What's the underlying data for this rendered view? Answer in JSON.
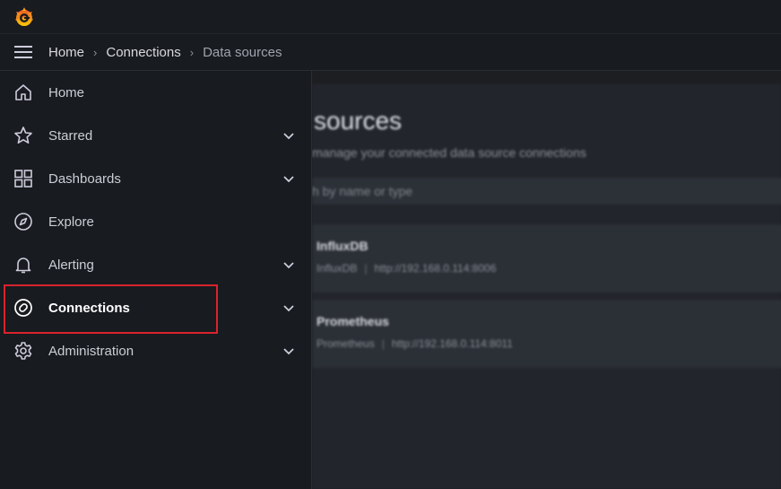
{
  "breadcrumb": {
    "items": [
      "Home",
      "Connections",
      "Data sources"
    ]
  },
  "sidebar": {
    "items": [
      {
        "label": "Home",
        "icon": "home-icon",
        "expandable": false
      },
      {
        "label": "Starred",
        "icon": "star-icon",
        "expandable": true
      },
      {
        "label": "Dashboards",
        "icon": "apps-icon",
        "expandable": true
      },
      {
        "label": "Explore",
        "icon": "compass-icon",
        "expandable": false
      },
      {
        "label": "Alerting",
        "icon": "bell-icon",
        "expandable": true
      },
      {
        "label": "Connections",
        "icon": "connections-icon",
        "expandable": true,
        "active": true
      },
      {
        "label": "Administration",
        "icon": "cog-icon",
        "expandable": true
      }
    ]
  },
  "main": {
    "title": "sources",
    "subtitle": "manage your connected data source connections",
    "search_placeholder": "h by name or type",
    "datasources": [
      {
        "name": "InfluxDB",
        "type": "InfluxDB",
        "url": "http://192.168.0.114:8006"
      },
      {
        "name": "Prometheus",
        "type": "Prometheus",
        "url": "http://192.168.0.114:8011"
      }
    ]
  },
  "colors": {
    "logo_orange": "#f05a28",
    "logo_yellow": "#fbca0a",
    "highlight": "#d9232e"
  }
}
